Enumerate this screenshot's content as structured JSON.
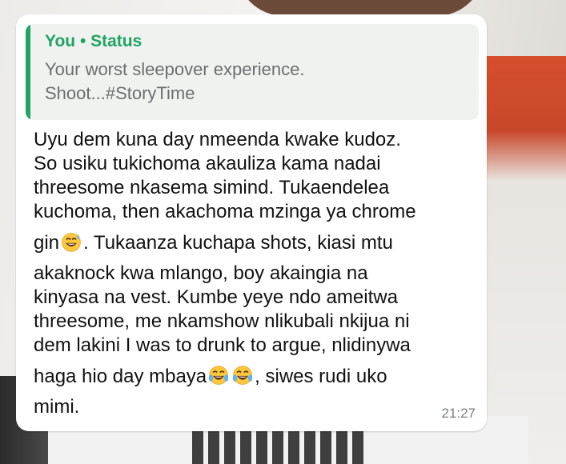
{
  "quoted": {
    "author": "You • Status",
    "text": "Your worst sleepover experience.\nShoot...#StoryTime"
  },
  "message": {
    "lines": [
      "Uyu dem kuna day nmeenda kwake kudoz.",
      "So usiku tukichoma akauliza kama nadai",
      "threesome nkasema simind. Tukaendelea",
      "kuchoma, then akachoma mzinga ya chrome",
      "gin",
      ". Tukaanza kuchapa shots, kiasi mtu",
      "akaknock kwa mlango,  boy akaingia na",
      "kinyasa na vest. Kumbe yeye ndo ameitwa",
      "threesome,  me nkamshow nlikubali nkijua ni",
      "dem lakini I was to drunk to argue, nlidinywa",
      "haga hio day mbaya",
      ", siwes rudi uko",
      "mimi."
    ],
    "time": "21:27"
  },
  "icons": {
    "sweat_smile": "grinning-face-with-sweat-icon",
    "joy": "face-with-tears-of-joy-icon"
  },
  "colors": {
    "accent": "#1fa463",
    "bubble": "#ffffff",
    "quote_bg": "#f0f2f0",
    "text": "#111111",
    "meta": "#7a7d7e"
  }
}
